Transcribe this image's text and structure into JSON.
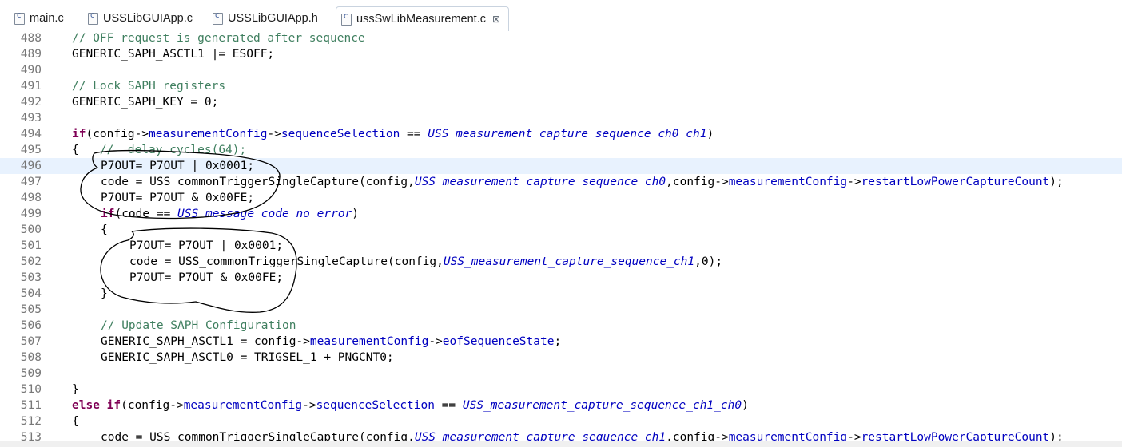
{
  "tabs": [
    {
      "label": "main.c"
    },
    {
      "label": "USSLibGUIApp.c"
    },
    {
      "label": "USSLibGUIApp.h"
    },
    {
      "label": "ussSwLibMeasurement.c",
      "close": "⊠"
    }
  ],
  "lines": [
    {
      "n": "488",
      "ind": 0,
      "segs": [
        {
          "t": "cm",
          "v": "// OFF request is generated after sequence"
        }
      ]
    },
    {
      "n": "489",
      "ind": 0,
      "segs": [
        {
          "t": "p",
          "v": "GENERIC_SAPH_ASCTL1 |= ESOFF;"
        }
      ]
    },
    {
      "n": "490",
      "ind": 0,
      "segs": []
    },
    {
      "n": "491",
      "ind": 0,
      "segs": [
        {
          "t": "cm",
          "v": "// Lock SAPH registers"
        }
      ]
    },
    {
      "n": "492",
      "ind": 0,
      "segs": [
        {
          "t": "p",
          "v": "GENERIC_SAPH_KEY = 0;"
        }
      ]
    },
    {
      "n": "493",
      "ind": 0,
      "segs": []
    },
    {
      "n": "494",
      "ind": 0,
      "segs": [
        {
          "t": "kw",
          "v": "if"
        },
        {
          "t": "p",
          "v": "(config->"
        },
        {
          "t": "fld",
          "v": "measurementConfig"
        },
        {
          "t": "p",
          "v": "->"
        },
        {
          "t": "fld",
          "v": "sequenceSelection"
        },
        {
          "t": "p",
          "v": " == "
        },
        {
          "t": "enum",
          "v": "USS_measurement_capture_sequence_ch0_ch1"
        },
        {
          "t": "p",
          "v": ")"
        }
      ]
    },
    {
      "n": "495",
      "ind": 0,
      "segs": [
        {
          "t": "p",
          "v": "{   "
        },
        {
          "t": "cm",
          "v": "//__delay_cycles(64);"
        }
      ]
    },
    {
      "n": "496",
      "ind": 1,
      "current": true,
      "segs": [
        {
          "t": "p",
          "v": "P7OUT= P7OUT | 0x0001;"
        }
      ]
    },
    {
      "n": "497",
      "ind": 1,
      "segs": [
        {
          "t": "p",
          "v": "code = USS_commonTriggerSingleCapture(config,"
        },
        {
          "t": "enum",
          "v": "USS_measurement_capture_sequence_ch0"
        },
        {
          "t": "p",
          "v": ",config->"
        },
        {
          "t": "fld",
          "v": "measurementConfig"
        },
        {
          "t": "p",
          "v": "->"
        },
        {
          "t": "fld",
          "v": "restartLowPowerCaptureCount"
        },
        {
          "t": "p",
          "v": ");"
        }
      ]
    },
    {
      "n": "498",
      "ind": 1,
      "segs": [
        {
          "t": "p",
          "v": "P7OUT= P7OUT & 0x00FE;"
        }
      ]
    },
    {
      "n": "499",
      "ind": 1,
      "segs": [
        {
          "t": "kw",
          "v": "if"
        },
        {
          "t": "p",
          "v": "(code == "
        },
        {
          "t": "enum",
          "v": "USS_message_code_no_error"
        },
        {
          "t": "p",
          "v": ")"
        }
      ]
    },
    {
      "n": "500",
      "ind": 1,
      "segs": [
        {
          "t": "p",
          "v": "{"
        }
      ]
    },
    {
      "n": "501",
      "ind": 2,
      "segs": [
        {
          "t": "p",
          "v": "P7OUT= P7OUT | 0x0001;"
        }
      ]
    },
    {
      "n": "502",
      "ind": 2,
      "segs": [
        {
          "t": "p",
          "v": "code = USS_commonTriggerSingleCapture(config,"
        },
        {
          "t": "enum",
          "v": "USS_measurement_capture_sequence_ch1"
        },
        {
          "t": "p",
          "v": ",0);"
        }
      ]
    },
    {
      "n": "503",
      "ind": 2,
      "segs": [
        {
          "t": "p",
          "v": "P7OUT= P7OUT & 0x00FE;"
        }
      ]
    },
    {
      "n": "504",
      "ind": 1,
      "segs": [
        {
          "t": "p",
          "v": "}"
        }
      ]
    },
    {
      "n": "505",
      "ind": 0,
      "segs": []
    },
    {
      "n": "506",
      "ind": 1,
      "segs": [
        {
          "t": "cm",
          "v": "// Update SAPH Configuration"
        }
      ]
    },
    {
      "n": "507",
      "ind": 1,
      "segs": [
        {
          "t": "p",
          "v": "GENERIC_SAPH_ASCTL1 = config->"
        },
        {
          "t": "fld",
          "v": "measurementConfig"
        },
        {
          "t": "p",
          "v": "->"
        },
        {
          "t": "fld",
          "v": "eofSequenceState"
        },
        {
          "t": "p",
          "v": ";"
        }
      ]
    },
    {
      "n": "508",
      "ind": 1,
      "segs": [
        {
          "t": "p",
          "v": "GENERIC_SAPH_ASCTL0 = TRIGSEL_1 + PNGCNT0;"
        }
      ]
    },
    {
      "n": "509",
      "ind": 0,
      "segs": []
    },
    {
      "n": "510",
      "ind": 0,
      "segs": [
        {
          "t": "p",
          "v": "}"
        }
      ]
    },
    {
      "n": "511",
      "ind": 0,
      "segs": [
        {
          "t": "kw",
          "v": "else if"
        },
        {
          "t": "p",
          "v": "(config->"
        },
        {
          "t": "fld",
          "v": "measurementConfig"
        },
        {
          "t": "p",
          "v": "->"
        },
        {
          "t": "fld",
          "v": "sequenceSelection"
        },
        {
          "t": "p",
          "v": " == "
        },
        {
          "t": "enum",
          "v": "USS_measurement_capture_sequence_ch1_ch0"
        },
        {
          "t": "p",
          "v": ")"
        }
      ]
    },
    {
      "n": "512",
      "ind": 0,
      "segs": [
        {
          "t": "p",
          "v": "{"
        }
      ]
    },
    {
      "n": "513",
      "ind": 1,
      "segs": [
        {
          "t": "p",
          "v": "code = USS_commonTriggerSingleCapture(config,"
        },
        {
          "t": "enum",
          "v": "USS_measurement_capture_sequence_ch1"
        },
        {
          "t": "p",
          "v": ",config->"
        },
        {
          "t": "fld",
          "v": "measurementConfig"
        },
        {
          "t": "p",
          "v": "->"
        },
        {
          "t": "fld",
          "v": "restartLowPowerCaptureCount"
        },
        {
          "t": "p",
          "v": ");"
        }
      ]
    }
  ]
}
